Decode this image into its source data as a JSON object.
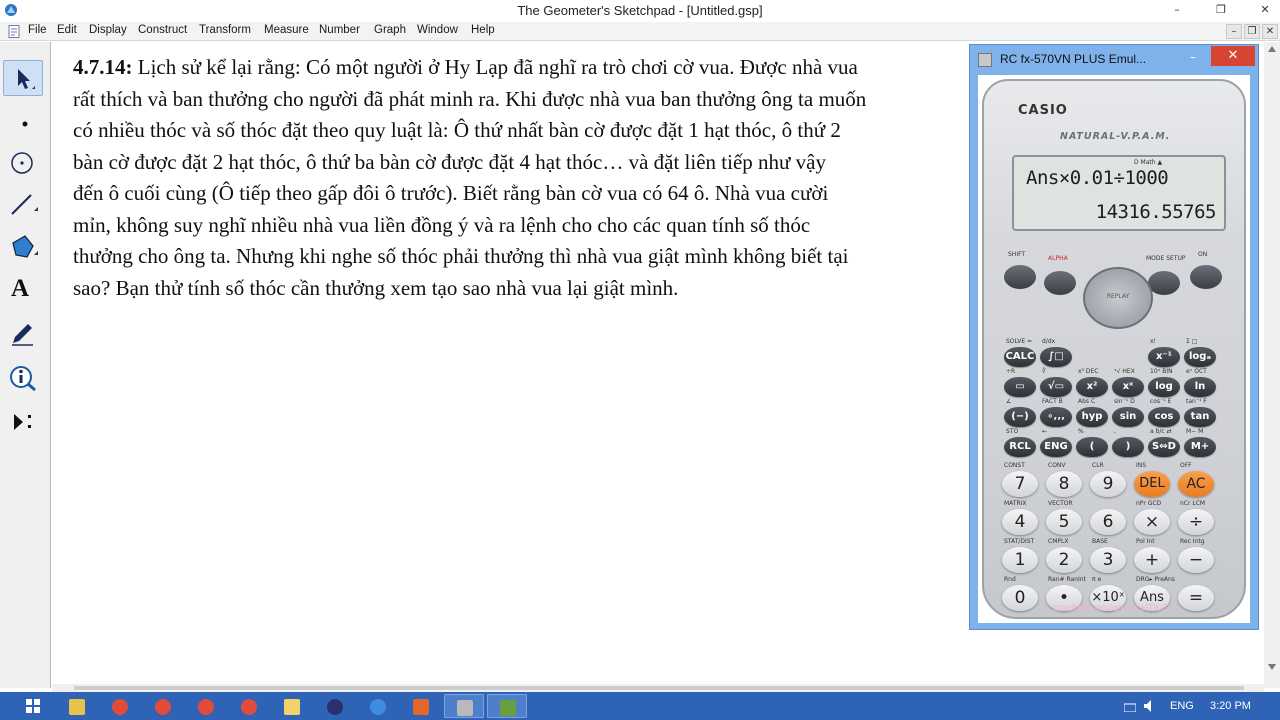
{
  "window": {
    "title": "The Geometer's Sketchpad - [Untitled.gsp]",
    "min": "–",
    "restore": "❐",
    "close": "✕"
  },
  "menu": {
    "items": [
      "File",
      "Edit",
      "Display",
      "Construct",
      "Transform",
      "Measure",
      "Number",
      "Graph",
      "Window",
      "Help"
    ],
    "doc_min": "–",
    "doc_restore": "❐",
    "doc_close": "✕"
  },
  "toolbox": {
    "tools": [
      "arrow-select-tool",
      "point-tool",
      "compass-tool",
      "straightedge-tool",
      "polygon-tool",
      "text-tool",
      "marker-tool",
      "information-tool",
      "custom-tool"
    ],
    "text_tool_glyph": "A"
  },
  "problem": {
    "number": "4.7.14:",
    "lines": [
      " Lịch sử kể lại rằng: Có một người ở Hy Lạp đã nghĩ ra trò chơi cờ vua. Được nhà vua",
      "rất thích và ban thưởng cho người đã phát minh ra. Khi được nhà vua ban thưởng ông ta muốn",
      "có nhiều thóc và số thóc đặt theo quy luật là: Ô thứ nhất bàn cờ được đặt 1 hạt thóc, ô thứ 2",
      "bàn cờ được đặt 2 hạt thóc, ô thứ ba bàn cờ được đặt 4 hạt thóc… và đặt liên tiếp như vậy",
      "đến ô cuối cùng (Ô tiếp theo gấp đôi ô trước). Biết rằng bàn cờ vua có 64 ô. Nhà vua cười",
      "mỉn, không suy nghĩ nhiều nhà vua liền đồng ý và ra lệnh cho cho các quan tính số thóc",
      "thưởng cho ông ta. Nhưng khi nghe số thóc phải thưởng thì nhà vua giật mình không biết tại",
      "sao? Bạn thử tính số thóc cần thưởng xem tạo sao nhà vua lại giật mình."
    ]
  },
  "calculator": {
    "window_title": "RC fx-570VN PLUS Emul...",
    "min": "–",
    "close": "✕",
    "brand": "CASIO",
    "model": "NATURAL-V.P.A.M.",
    "indicators": "D                  Math ▲",
    "expression": "Ans×0.01÷1000",
    "result": "14316.55765",
    "footer": "cracked version for HTKC :)",
    "replay": "REPLAY",
    "top_labels": {
      "shift": "SHIFT",
      "alpha": "ALPHA",
      "mode": "MODE SETUP",
      "on": "ON"
    },
    "row1": [
      "CALC",
      "∫□",
      "",
      "",
      "x⁻¹",
      "logₐ"
    ],
    "row2": [
      "▭",
      "√▭",
      "x²",
      "xˣ",
      "log",
      "ln"
    ],
    "row3": [
      "(−)",
      "∘‚‚‚",
      "hyp",
      "sin",
      "cos",
      "tan"
    ],
    "row4": [
      "RCL",
      "ENG",
      "(",
      ")",
      "S⇔D",
      "M+"
    ],
    "num_row1": [
      "7",
      "8",
      "9",
      "DEL",
      "AC"
    ],
    "num_row2": [
      "4",
      "5",
      "6",
      "×",
      "÷"
    ],
    "num_row3": [
      "1",
      "2",
      "3",
      "+",
      "−"
    ],
    "num_row4": [
      "0",
      "•",
      "×10ˣ",
      "Ans",
      "="
    ],
    "sub_labels": {
      "r1": [
        "SOLVE =",
        "d/dx",
        ":",
        "",
        "x!",
        "Σ  □"
      ],
      "r2": [
        "÷R",
        "∛",
        "x³ DEC",
        "ˣ√ HEX",
        "10ˣ BIN",
        "eˣ OCT"
      ],
      "r3": [
        "∠",
        "FACT B",
        "Abs C",
        "sin⁻¹ D",
        "cos⁻¹ E",
        "tan⁻¹ F"
      ],
      "r4": [
        "STO",
        "←",
        "%",
        ",",
        "a b/c ⇄",
        "M− M"
      ],
      "n1": [
        "CONST",
        "CONV",
        "CLR",
        "INS",
        "OFF"
      ],
      "n2": [
        "MATRIX",
        "VECTOR",
        "",
        "nPr GCD",
        "nCr LCM"
      ],
      "n3": [
        "STAT/DIST",
        "CMPLX",
        "BASE",
        "Pol Int",
        "Rec Intg"
      ],
      "n4": [
        "Rnd",
        "Ran# RanInt",
        "π  e",
        "DRG▸ PreAns",
        ""
      ]
    }
  },
  "taskbar": {
    "apps": [
      "file-explorer",
      "chrome",
      "chrome",
      "chrome",
      "chrome",
      "folder",
      "media-player",
      "browser",
      "pdf-reader",
      "sketchpad",
      "calculator-emulator"
    ],
    "lang": "ENG",
    "time": "3:20 PM"
  }
}
